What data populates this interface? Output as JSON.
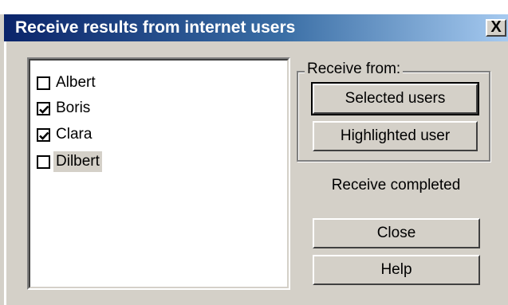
{
  "window": {
    "title": "Receive results from internet users",
    "close_glyph": "X"
  },
  "users": [
    {
      "name": "Albert",
      "checked": false,
      "highlighted": false
    },
    {
      "name": "Boris",
      "checked": true,
      "highlighted": false
    },
    {
      "name": "Clara",
      "checked": true,
      "highlighted": false
    },
    {
      "name": "Dilbert",
      "checked": false,
      "highlighted": true
    }
  ],
  "receive_from": {
    "label": "Receive from:",
    "selected_users_label": "Selected users",
    "highlighted_user_label": "Highlighted user"
  },
  "status_text": "Receive completed",
  "buttons": {
    "close_label": "Close",
    "help_label": "Help"
  },
  "colors": {
    "title_gradient_start": "#0a246a",
    "title_gradient_end": "#a6caf0",
    "dialog_face": "#d4d0c8"
  }
}
